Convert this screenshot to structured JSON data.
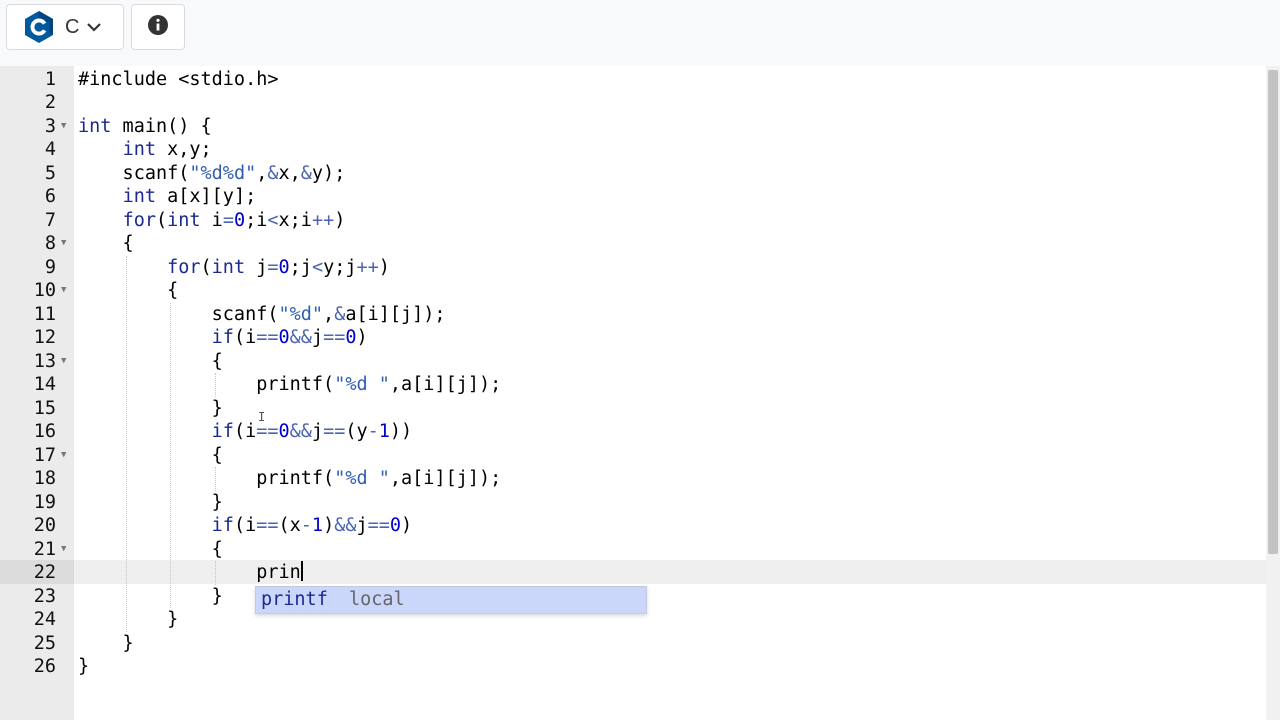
{
  "toolbar": {
    "language_label": "C",
    "language_icon": "c-language-logo-icon",
    "dropdown_icon": "chevron-down-icon",
    "info_icon": "info-icon"
  },
  "editor": {
    "lines": [
      {
        "n": "1",
        "text": "#include <stdio.h>"
      },
      {
        "n": "2",
        "text": ""
      },
      {
        "n": "3",
        "text": "int main() {"
      },
      {
        "n": "4",
        "text": "    int x,y;"
      },
      {
        "n": "5",
        "text": "    scanf(\"%d%d\",&x,&y);"
      },
      {
        "n": "6",
        "text": "    int a[x][y];"
      },
      {
        "n": "7",
        "text": "    for(int i=0;i<x;i++)"
      },
      {
        "n": "8",
        "text": "    {"
      },
      {
        "n": "9",
        "text": "        for(int j=0;j<y;j++)"
      },
      {
        "n": "10",
        "text": "        {"
      },
      {
        "n": "11",
        "text": "            scanf(\"%d\",&a[i][j]);"
      },
      {
        "n": "12",
        "text": "            if(i==0&&j==0)"
      },
      {
        "n": "13",
        "text": "            {"
      },
      {
        "n": "14",
        "text": "                printf(\"%d \",a[i][j]);"
      },
      {
        "n": "15",
        "text": "            }"
      },
      {
        "n": "16",
        "text": "            if(i==0&&j==(y-1))"
      },
      {
        "n": "17",
        "text": "            {"
      },
      {
        "n": "18",
        "text": "                printf(\"%d \",a[i][j]);"
      },
      {
        "n": "19",
        "text": "            }"
      },
      {
        "n": "20",
        "text": "            if(i==(x-1)&&j==0)"
      },
      {
        "n": "21",
        "text": "            {"
      },
      {
        "n": "22",
        "text": "                prin"
      },
      {
        "n": "23",
        "text": "            }"
      },
      {
        "n": "24",
        "text": "        }"
      },
      {
        "n": "25",
        "text": "    }"
      },
      {
        "n": "26",
        "text": "}"
      }
    ],
    "fold_lines": [
      "3",
      "8",
      "10",
      "13",
      "17",
      "21"
    ],
    "active_line": "22",
    "autocomplete": {
      "suggestion": "printf",
      "meta": "local"
    }
  },
  "colors": {
    "keyword": "#1a2a8f",
    "string": "#2f5eb1",
    "numeric": "#0000cd",
    "autocomplete_bg": "#cad6fa"
  }
}
